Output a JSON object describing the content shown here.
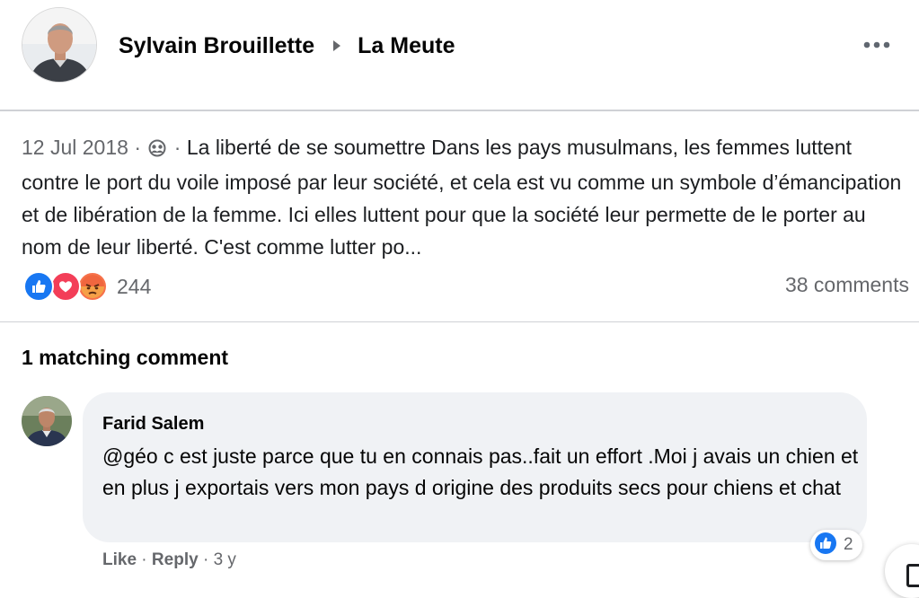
{
  "post": {
    "author": "Sylvain Brouillette",
    "group": "La Meute",
    "date": "12 Jul 2018",
    "separator": " · ",
    "text": "La liberté de se soumettre Dans les pays musulmans, les femmes luttent contre le port du voile imposé par leur société, et cela est vu comme un symbole d’émancipation et de libération de la femme. Ici elles luttent pour que la société leur permette de le porter au nom de leur liberté. C'est comme lutter po...",
    "reactions_count": "244",
    "comments_count": "38 comments",
    "reaction_icons": [
      "like-icon",
      "love-icon",
      "angry-icon"
    ]
  },
  "comments_section": {
    "heading": "1 matching comment"
  },
  "comment": {
    "author": "Farid Salem",
    "text": "@géo c est juste parce que tu en connais pas..fait un effort .Moi j avais un chien et en plus j exportais vers mon pays d origine des produits secs pour chiens et chat",
    "reaction_count": "2",
    "like_label": "Like",
    "reply_label": "Reply",
    "dot": " · ",
    "time": "3 y"
  },
  "colors": {
    "like_blue": "#1877f2",
    "love_red": "#f33e58",
    "angry_orange": "#f7714b",
    "secondary_text": "#65676b",
    "bubble_bg": "#f0f2f5"
  }
}
